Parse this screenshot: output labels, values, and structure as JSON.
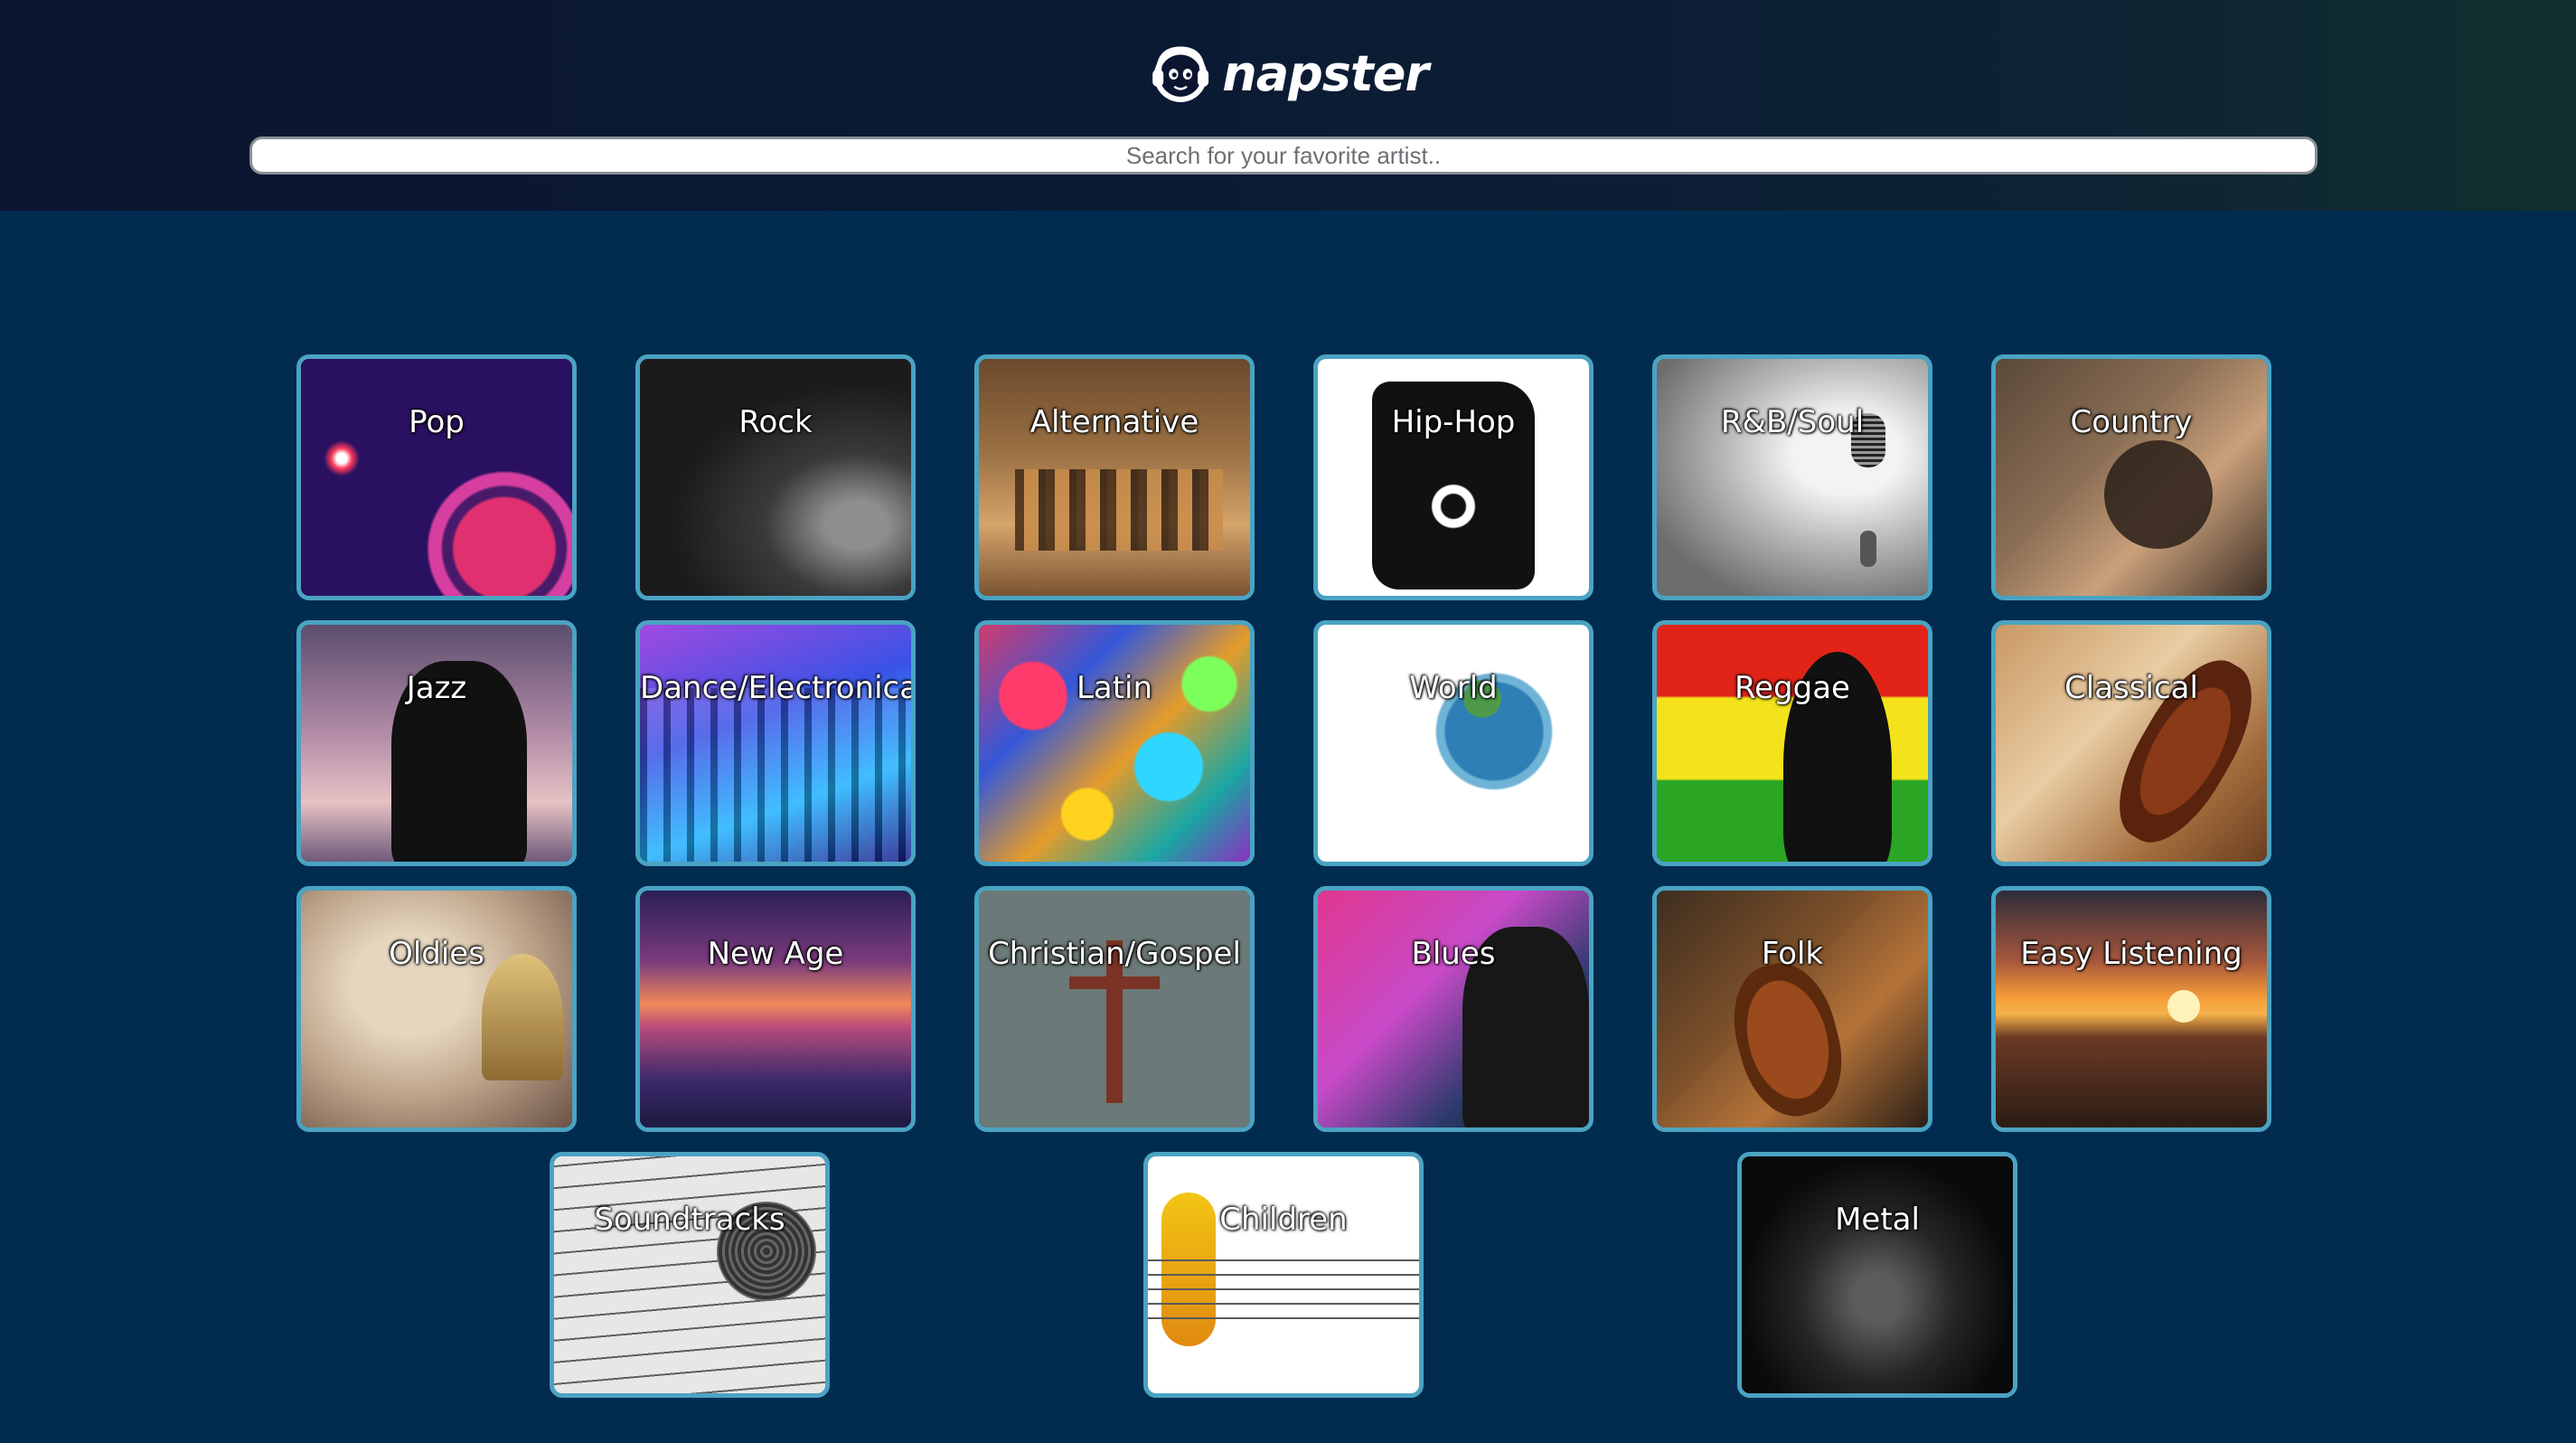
{
  "header": {
    "brand_name": "napster",
    "logo_icon": "napster-cat-headphones-icon"
  },
  "search": {
    "placeholder": "Search for your favorite artist.."
  },
  "genres": [
    {
      "label": "Pop"
    },
    {
      "label": "Rock"
    },
    {
      "label": "Alternative"
    },
    {
      "label": "Hip-Hop"
    },
    {
      "label": "R&B/Soul"
    },
    {
      "label": "Country"
    },
    {
      "label": "Jazz"
    },
    {
      "label": "Dance/Electronica"
    },
    {
      "label": "Latin"
    },
    {
      "label": "World"
    },
    {
      "label": "Reggae"
    },
    {
      "label": "Classical"
    },
    {
      "label": "Oldies"
    },
    {
      "label": "New Age"
    },
    {
      "label": "Christian/Gospel"
    },
    {
      "label": "Blues"
    },
    {
      "label": "Folk"
    },
    {
      "label": "Easy Listening"
    },
    {
      "label": "Soundtracks"
    },
    {
      "label": "Children"
    },
    {
      "label": "Metal"
    }
  ],
  "colors": {
    "page_background": "#022c4f",
    "tile_border": "#4aa3c3"
  }
}
